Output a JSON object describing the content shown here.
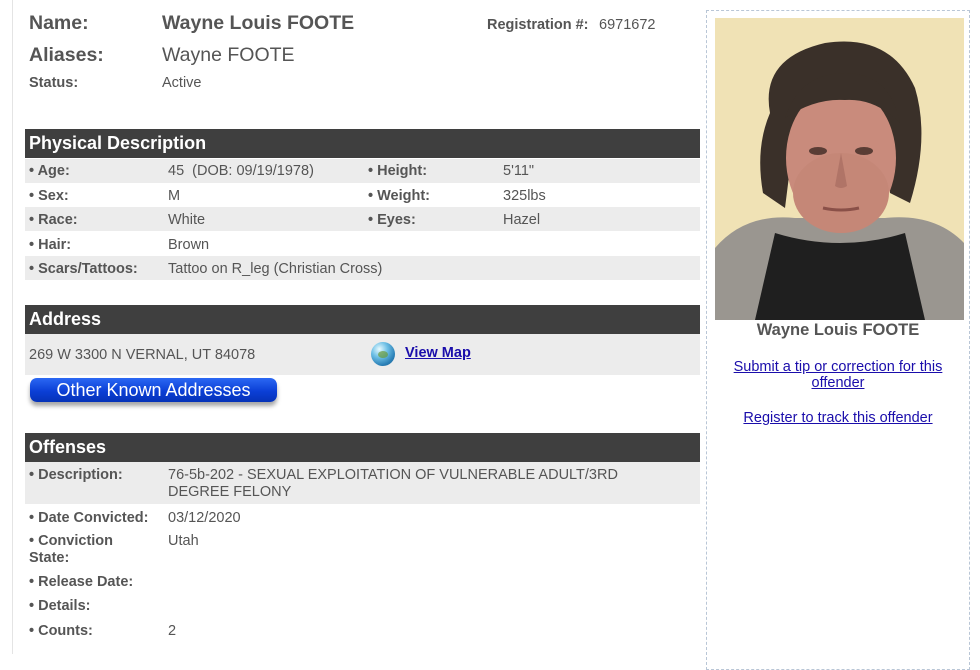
{
  "header": {
    "name_label": "Name:",
    "name_value": "Wayne Louis FOOTE",
    "aliases_label": "Aliases:",
    "aliases_value": "Wayne FOOTE",
    "status_label": "Status:",
    "status_value": "Active",
    "registration_label": "Registration #:",
    "registration_value": "6971672"
  },
  "physical": {
    "title": "Physical Description",
    "age_label": "• Age:",
    "age_value": "45  (DOB: 09/19/1978)",
    "height_label": "• Height:",
    "height_value": "5'11\"",
    "sex_label": "• Sex:",
    "sex_value": "M",
    "weight_label": "• Weight:",
    "weight_value": "325lbs",
    "race_label": "• Race:",
    "race_value": "White",
    "eyes_label": "• Eyes:",
    "eyes_value": "Hazel",
    "hair_label": "• Hair:",
    "hair_value": "Brown",
    "scars_label": "• Scars/Tattoos:",
    "scars_value": "Tattoo on R_leg (Christian Cross)"
  },
  "address": {
    "title": "Address",
    "value": "269 W 3300 N VERNAL, UT 84078",
    "view_map": "View Map",
    "other_addresses_button": "Other Known Addresses",
    "icon": "globe-icon"
  },
  "offenses": {
    "title": "Offenses",
    "description_label": "• Description:",
    "description_value": "76-5b-202 - SEXUAL EXPLOITATION OF VULNERABLE ADULT/3RD DEGREE FELONY",
    "date_convicted_label": "• Date Convicted:",
    "date_convicted_value": "03/12/2020",
    "conviction_state_label": "• Conviction State:",
    "conviction_state_value": "Utah",
    "release_date_label": "• Release Date:",
    "release_date_value": "",
    "details_label": "• Details:",
    "details_value": "",
    "counts_label": "• Counts:",
    "counts_value": "2"
  },
  "sidebar": {
    "photo_name": "Wayne Louis FOOTE",
    "tip_link": "Submit a tip or correction for this offender",
    "register_link": "Register to track this offender"
  },
  "colors": {
    "section_bar": "#3f3f3f",
    "row_gray": "#ececec",
    "link": "#1a0dab",
    "button_blue": "#0b3fd6"
  }
}
